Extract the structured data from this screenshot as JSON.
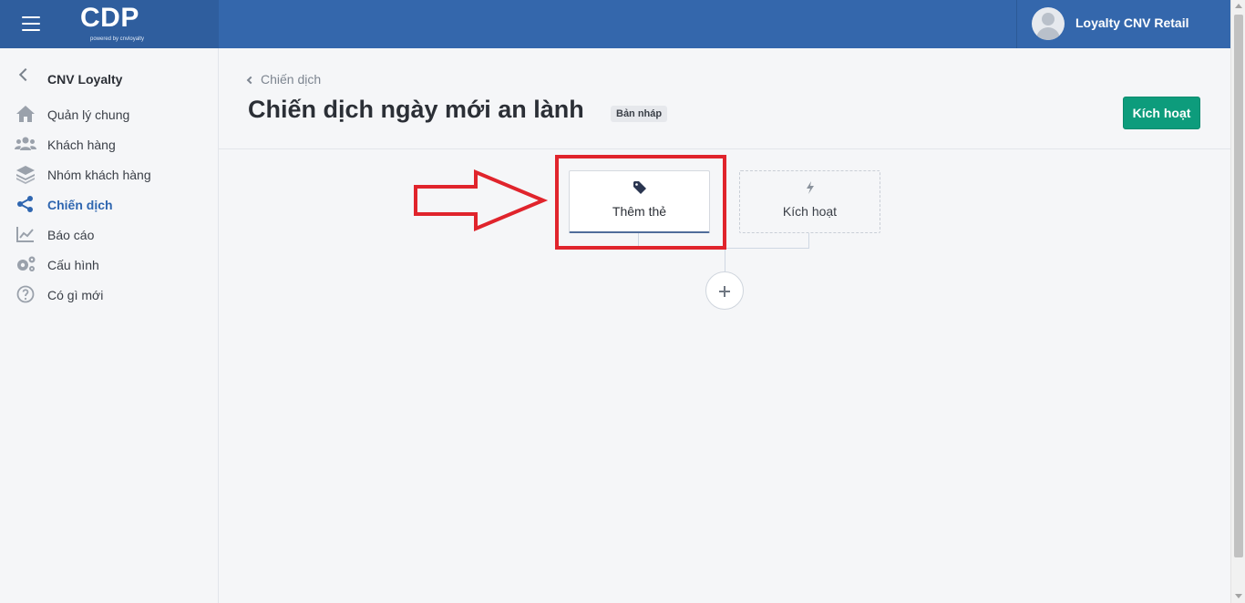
{
  "header": {
    "logo_text": "CDP",
    "logo_subtext": "powered by cnvloyalty",
    "user_name": "Loyalty CNV Retail"
  },
  "sidebar": {
    "back_label": "CNV Loyalty",
    "items": [
      {
        "label": "Quản lý chung",
        "icon": "home-icon"
      },
      {
        "label": "Khách hàng",
        "icon": "users-icon"
      },
      {
        "label": "Nhóm khách hàng",
        "icon": "layers-icon"
      },
      {
        "label": "Chiến dịch",
        "icon": "share-icon",
        "active": true
      },
      {
        "label": "Báo cáo",
        "icon": "chart-icon"
      },
      {
        "label": "Cấu hình",
        "icon": "gears-icon"
      },
      {
        "label": "Có gì mới",
        "icon": "question-icon"
      }
    ]
  },
  "main": {
    "breadcrumb": "Chiến dịch",
    "title": "Chiến dịch ngày mới an lành",
    "status_badge": "Bản nháp",
    "activate_button": "Kích hoạt"
  },
  "workflow": {
    "nodes": [
      {
        "label": "Thêm thẻ",
        "icon": "tag-icon"
      },
      {
        "label": "Kích hoạt",
        "icon": "bolt-icon"
      }
    ],
    "add_step_icon": "plus-icon"
  },
  "colors": {
    "topbar": "#3467ac",
    "brand_panel": "#2f5e9e",
    "accent_active": "#2f66b0",
    "activate_button": "#0d9c7c",
    "annotation": "#e0242c"
  }
}
